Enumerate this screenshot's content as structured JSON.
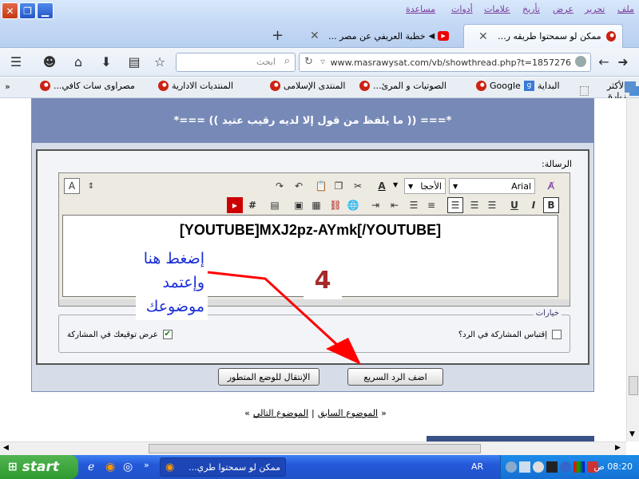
{
  "menubar": {
    "items": [
      "ملف",
      "تحرير",
      "عرض",
      "تأريخ",
      "علامات",
      "أدوات",
      "مساعدة"
    ]
  },
  "tabs": [
    {
      "title": "ممكن لو سمحتوا طريقه ر..."
    },
    {
      "title": "خطبة العريفي عن مصر ..."
    }
  ],
  "nav": {
    "url": "www.masrawysat.com/vb/showthread.php?t=1857276",
    "search_placeholder": "ابحث"
  },
  "bookmarks": [
    "الأكثر زيارة",
    "البداية",
    "Google",
    "الصوتيات و المرئ...",
    "المنتدى الإسلامى",
    "المنتديات الادارية",
    "مصراوى سات كافي..."
  ],
  "forum": {
    "header_text": "*=== (( ما يلفظ من قول إلا لديه رقيب عتيد )) ===*",
    "message_label": "الرسالة:",
    "font_name": "Arial",
    "size_label": "الأحجا",
    "editor_content": "[YOUTUBE]MXJ2pz-AYmk[/YOUTUBE]",
    "options_legend": "خيارات",
    "quote_option": "إقتباس المشاركة في الرد؟",
    "signature_option": "عرض توقيعك في المشاركة",
    "submit_button": "اضف الرد السريع",
    "advanced_button": "الإنتقال للوضع المتطور",
    "prev_thread": "الموضوع السابق",
    "next_thread": "الموضوع التالي",
    "separator": "|",
    "quote_open": "«",
    "quote_close": "»"
  },
  "annotation": {
    "instruction": [
      "إضغط هنا",
      "وإعتمد",
      "موضوعك"
    ],
    "step_number": "4",
    "color": "#ff0000"
  },
  "taskbar": {
    "start_label": "start",
    "task_title": "ممكن لو سمحتوا طري...",
    "language": "AR",
    "clock": "08:20 ص"
  }
}
